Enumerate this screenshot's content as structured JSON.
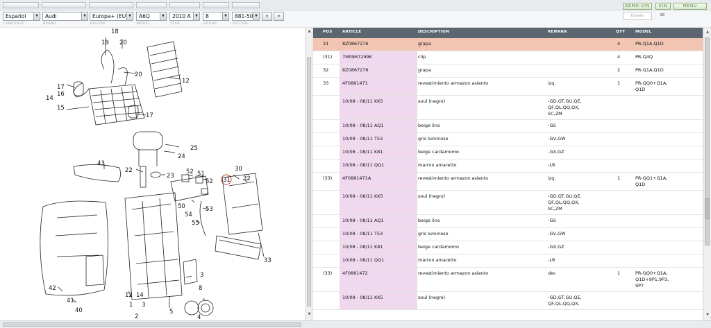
{
  "top_buttons": {
    "demo_vin": "DEMO-VIN",
    "vin": "VIN",
    "menu": "MENU"
  },
  "selectors": {
    "language": "Español",
    "brand": "Audi",
    "region": "Europa+ (EU)",
    "model": "A6Q",
    "year": "2010  A",
    "group": "8",
    "picture": "881-50",
    "prev": "«",
    "next": "»"
  },
  "donate_placeholder": "Donate",
  "counter": "38",
  "labels": {
    "language": "LANGUAGE",
    "brand": "BRAND",
    "region": "REGION",
    "model": "MODEL",
    "year": "YEAR",
    "group": "GROUP",
    "picture": "PICTURE"
  },
  "diagram": {
    "callouts": [
      "18",
      "19",
      "20",
      "20",
      "12",
      "17",
      "16",
      "14",
      "15",
      "17",
      "25",
      "24",
      "43",
      "22",
      "23",
      "52",
      "51",
      "52",
      "50",
      "54",
      "53",
      "55",
      "31",
      "30",
      "32",
      "33",
      "42",
      "41",
      "40",
      "12",
      "14",
      "1",
      "3",
      "2",
      "3",
      "5",
      "8",
      "4"
    ]
  },
  "table": {
    "headers": {
      "pos": "POS",
      "article": "ARTICLE",
      "description": "DESCRIPTION",
      "remark": "REMARK",
      "qty": "QTY",
      "model": "MODEL"
    },
    "rows": [
      {
        "pos": "31",
        "article": "8Z0867276",
        "description": "grapa",
        "remark": "",
        "qty": "4",
        "model": "PR-Q1A,Q1D"
      },
      {
        "pos": "(31)",
        "article": "7M0867299K",
        "description": "clip",
        "remark": "",
        "qty": "4",
        "model": "PR-Q4Q"
      },
      {
        "pos": "32",
        "article": "8Z0867276",
        "description": "grapa",
        "remark": "",
        "qty": "2",
        "model": "PR-Q1A,Q1D"
      },
      {
        "pos": "33",
        "article": "4F0881471",
        "description": "revestimiento armazon asiento",
        "remark": "izq.",
        "qty": "1",
        "model": "PR-QQ0+Q1A,\nQ1D"
      },
      {
        "pos": "",
        "article": "10/08 - 08/11  KK5",
        "description": "soul (negro)",
        "remark": "-GD,GT,GU,QE,\nQF,QL,QQ,QX,\nSC,ZM",
        "qty": "",
        "model": ""
      },
      {
        "pos": "",
        "article": "10/08 - 08/11  AQ1",
        "description": "beige lino",
        "remark": "-GS",
        "qty": "",
        "model": ""
      },
      {
        "pos": "",
        "article": "10/08 - 08/11  T53",
        "description": "gris luminoso",
        "remark": "-GV,GW",
        "qty": "",
        "model": ""
      },
      {
        "pos": "",
        "article": "10/08 - 08/11  K81",
        "description": "beige cardamomo",
        "remark": "-GX,GZ",
        "qty": "",
        "model": ""
      },
      {
        "pos": "",
        "article": "10/08 - 08/11  QQ1",
        "description": "marron amaretto",
        "remark": "-LR",
        "qty": "",
        "model": ""
      },
      {
        "pos": "(33)",
        "article": "4F0881471A",
        "description": "revestimiento armazon asiento",
        "remark": "izq.",
        "qty": "1",
        "model": "PR-QQ1+Q1A,\nQ1D"
      },
      {
        "pos": "",
        "article": "10/08 - 08/11  KK5",
        "description": "soul (negro)",
        "remark": "-GD,GT,GU,QE,\nQF,QL,QQ,QX,\nSC,ZM",
        "qty": "",
        "model": ""
      },
      {
        "pos": "",
        "article": "10/08 - 08/11  AQ1",
        "description": "beige lino",
        "remark": "-GS",
        "qty": "",
        "model": ""
      },
      {
        "pos": "",
        "article": "10/08 - 08/11  T53",
        "description": "gris luminoso",
        "remark": "-GV,GW",
        "qty": "",
        "model": ""
      },
      {
        "pos": "",
        "article": "10/08 - 08/11  K81",
        "description": "beige cardamomo",
        "remark": "-GX,GZ",
        "qty": "",
        "model": ""
      },
      {
        "pos": "",
        "article": "10/08 - 08/11  QQ1",
        "description": "marron amaretto",
        "remark": "-LR",
        "qty": "",
        "model": ""
      },
      {
        "pos": "(33)",
        "article": "4F0881472",
        "description": "revestimiento armazon asiento",
        "remark": "der.",
        "qty": "1",
        "model": "PR-QQ0+Q1A,\nQ1D+9P1,9P3,\n9P7"
      },
      {
        "pos": "",
        "article": "10/08 - 08/11  KK5",
        "description": "soul (negro)",
        "remark": "-GD,GT,GU,QE,\nQF,QL,QQ,QX,",
        "qty": "",
        "model": ""
      }
    ]
  },
  "colors": {
    "header_bg": "#5b6671",
    "selected_row": "#f2c5b3",
    "article_bg": "#f0d9ee",
    "green_button": "#d6e9cb"
  }
}
